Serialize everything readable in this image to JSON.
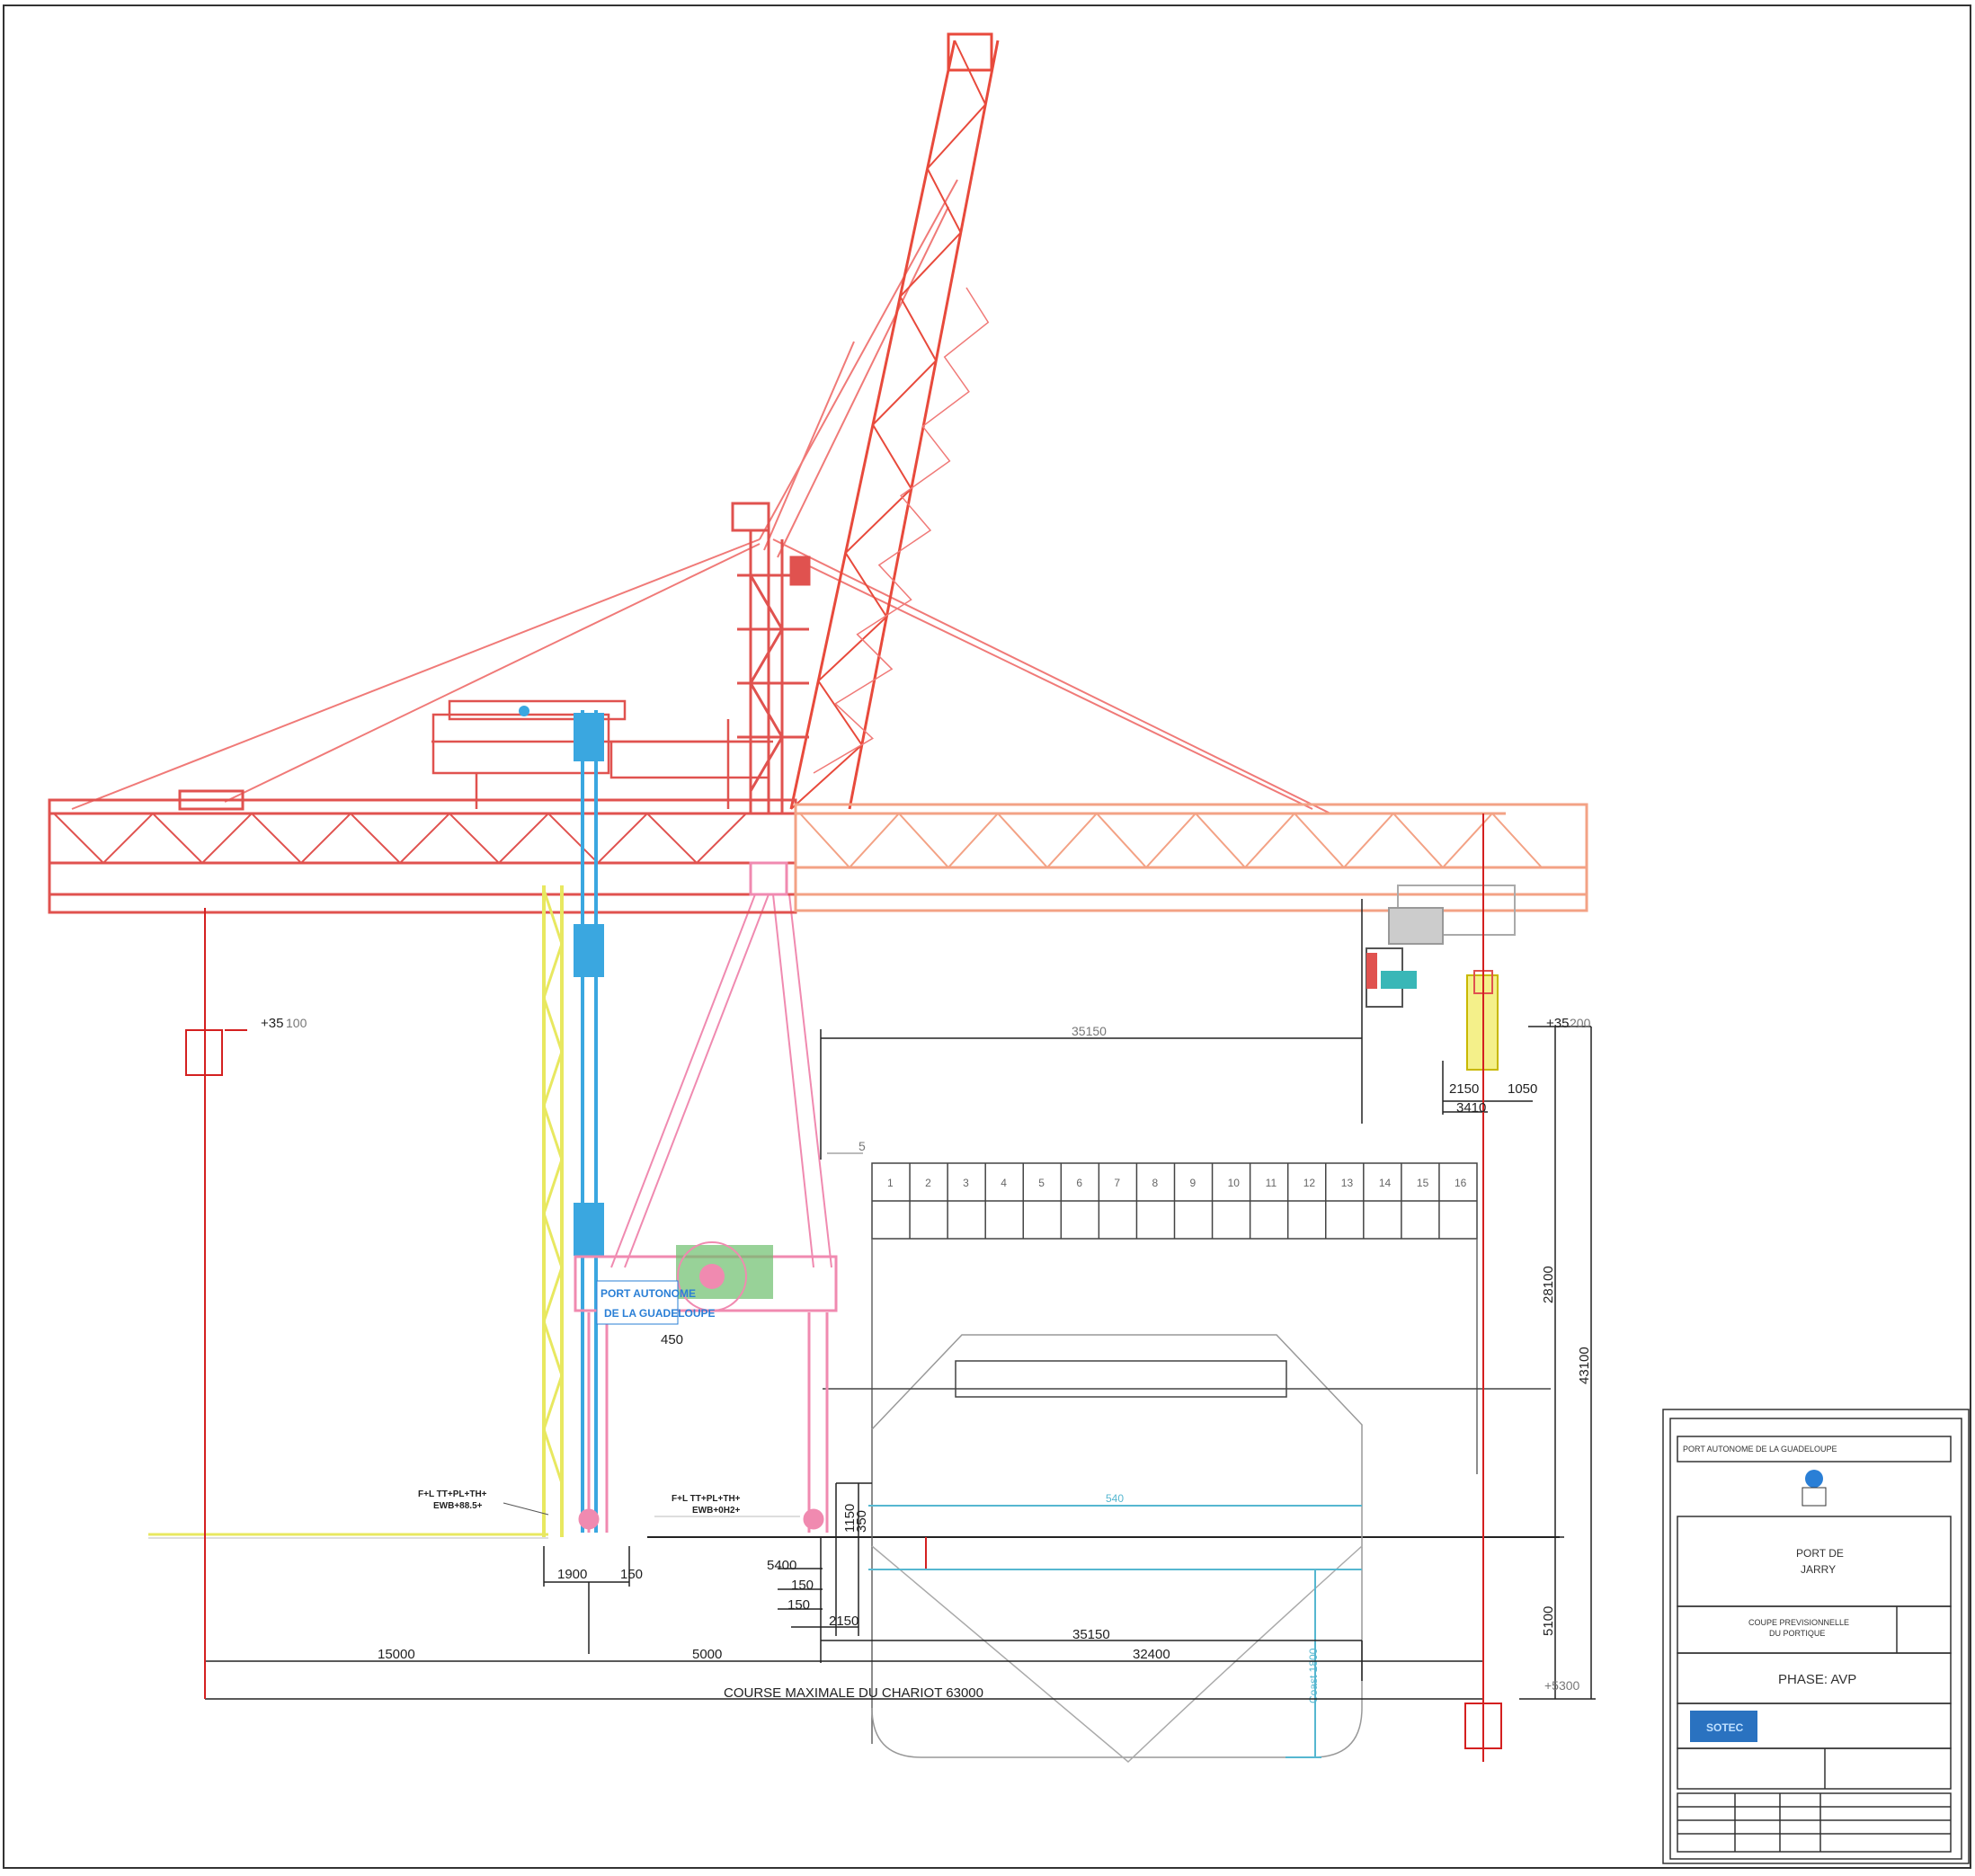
{
  "drawing": {
    "crane_sign": {
      "line1": "PORT AUTONOME",
      "line2": "DE LA GUADELOUPE"
    },
    "rail_left": {
      "line1": "F+L TT+PL+TH+",
      "line2": "EWB+88.5+"
    },
    "rail_right": {
      "line1": "F+L TT+PL+TH+",
      "line2": "EWB+0H2+"
    },
    "hold_numbers": [
      "1",
      "2",
      "3",
      "4",
      "5",
      "6",
      "7",
      "8",
      "9",
      "10",
      "11",
      "12",
      "13",
      "14",
      "15",
      "16"
    ],
    "dims": {
      "elev_left": "+35",
      "elev_left_small": "100",
      "elev_right": "+35",
      "elev_right_small": "200",
      "top_span": "35150",
      "small_top": "5",
      "trolley_a": "2150",
      "trolley_b": "1050",
      "trolley_c": "3410",
      "vertical_right": "28100",
      "vertical_outer": "43100",
      "vertical_lower": "5100",
      "ground_elev": "+5300",
      "leg_a": "1900",
      "leg_b": "150",
      "step_a": "5400",
      "step_b": "150",
      "step_c": "150",
      "step_d": "2150",
      "side_a": "1150",
      "side_b": "350",
      "dim_left": "15000",
      "dim_mid": "5000",
      "dim_ship": "35150",
      "dim_ship2": "32400",
      "course_label": "COURSE MAXIMALE DU CHARIOT 63000",
      "small_dim": "450",
      "cyan_dim": "540",
      "ship_depth": "Coast 1800"
    }
  },
  "title_block": {
    "owner": "PORT AUTONOME DE LA GUADELOUPE",
    "project_line1": "PORT DE",
    "project_line2": "JARRY",
    "drawing_title_line1": "COUPE PREVISIONNELLE",
    "drawing_title_line2": "DU PORTIQUE",
    "phase": "PHASE: AVP",
    "company_logo": "SOTEC"
  },
  "colors": {
    "crane_main": "#e0524f",
    "boom": "#e84a3c",
    "boom_light": "#f07a78",
    "girder_right": "#f3a285",
    "leg_yellow": "#e8e860",
    "mast_blue": "#3aa7e0",
    "pink_stay": "#f08ab0",
    "ship_outline": "#555555",
    "cyan": "#56b7d0",
    "red_dim": "#d42020"
  }
}
